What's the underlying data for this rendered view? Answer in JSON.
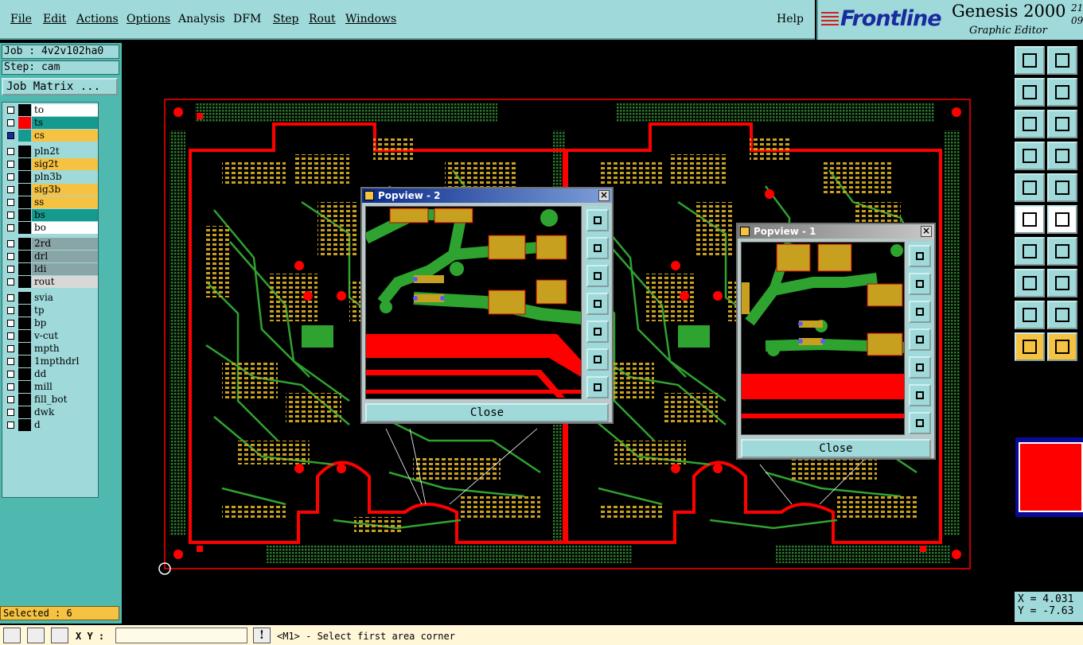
{
  "menu": [
    "File",
    "Edit",
    "Actions",
    "Options",
    "Analysis",
    "DFM",
    "Step",
    "Rout",
    "Windows"
  ],
  "help": "Help",
  "brand": {
    "logo": "Frontline",
    "title": "Genesis 2000",
    "subtitle": "Graphic Editor",
    "version": "21\n09"
  },
  "job": {
    "job": "Job : 4v2v102ha0",
    "step": "Step: cam",
    "matrix": "Job Matrix ..."
  },
  "layers": [
    {
      "name": "to",
      "color": "#ffffff",
      "swatch": "#000000"
    },
    {
      "name": "ts",
      "color": "#149a8e",
      "swatch": "#ff0000"
    },
    {
      "name": "cs",
      "color": "#f5c242",
      "swatch": "#149a8e"
    },
    {
      "name": "pln2t",
      "color": "#9fd9d9",
      "swatch": "#000000"
    },
    {
      "name": "sig2t",
      "color": "#f5c242",
      "swatch": "#000000"
    },
    {
      "name": "pln3b",
      "color": "#9fd9d9",
      "swatch": "#000000"
    },
    {
      "name": "sig3b",
      "color": "#f5c242",
      "swatch": "#000000"
    },
    {
      "name": "ss",
      "color": "#f5c242",
      "swatch": "#000000"
    },
    {
      "name": "bs",
      "color": "#149a8e",
      "swatch": "#000000"
    },
    {
      "name": "bo",
      "color": "#ffffff",
      "swatch": "#000000"
    },
    {
      "name": "2rd",
      "color": "#8aa5a5",
      "swatch": "#000000"
    },
    {
      "name": "drl",
      "color": "#8aa5a5",
      "swatch": "#000000"
    },
    {
      "name": "ldi",
      "color": "#8aa5a5",
      "swatch": "#000000"
    },
    {
      "name": "rout",
      "color": "#d8d8d8",
      "swatch": "#000000"
    },
    {
      "name": "svia",
      "color": "#9fd9d9",
      "swatch": "#000000"
    },
    {
      "name": "tp",
      "color": "#9fd9d9",
      "swatch": "#000000"
    },
    {
      "name": "bp",
      "color": "#9fd9d9",
      "swatch": "#000000"
    },
    {
      "name": "v-cut",
      "color": "#9fd9d9",
      "swatch": "#000000"
    },
    {
      "name": "mpth",
      "color": "#9fd9d9",
      "swatch": "#000000"
    },
    {
      "name": "1mpthdrl",
      "color": "#9fd9d9",
      "swatch": "#000000"
    },
    {
      "name": "dd",
      "color": "#9fd9d9",
      "swatch": "#000000"
    },
    {
      "name": "mill",
      "color": "#9fd9d9",
      "swatch": "#000000"
    },
    {
      "name": "fill_bot",
      "color": "#9fd9d9",
      "swatch": "#000000"
    },
    {
      "name": "dwk",
      "color": "#9fd9d9",
      "swatch": "#000000"
    },
    {
      "name": "d",
      "color": "#9fd9d9",
      "swatch": "#000000"
    }
  ],
  "selected": "Selected : 6",
  "xy_label": "X Y :",
  "prompt": "<M1> - Select first area corner",
  "coords": {
    "x": "X = 4.031",
    "y": "Y = -7.63"
  },
  "popups": [
    {
      "title": "Popview - 2",
      "close": "Close"
    },
    {
      "title": "Popview - 1",
      "close": "Close"
    }
  ],
  "colors": {
    "trace": "#2fa32f",
    "pad": "#c8a020",
    "copper": "#ff0000",
    "panel": "#9fd9d9",
    "active": "#f5c242"
  }
}
